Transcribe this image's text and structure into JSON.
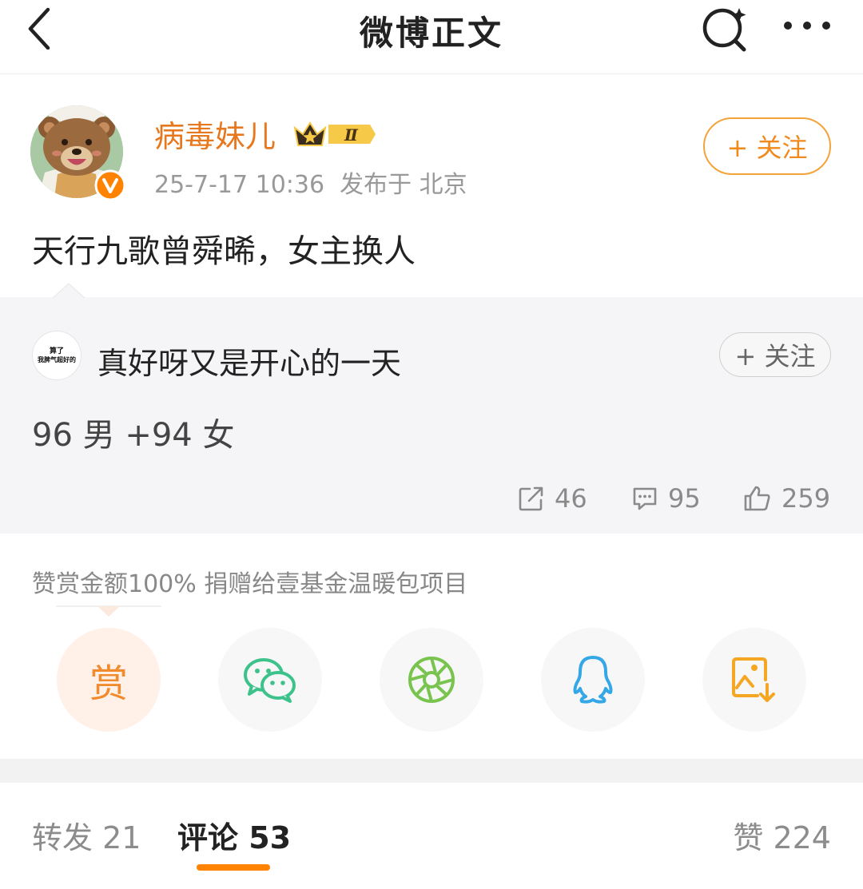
{
  "header": {
    "title": "微博正文"
  },
  "post": {
    "author": "病毒妹儿",
    "level_badge": "Ⅱ",
    "meta": "25-7-17 10:36  发布于 北京",
    "follow_label": "+ 关注",
    "text": "天行九歌曾舜晞，女主换人"
  },
  "quote": {
    "avatar_text_1": "算了",
    "avatar_text_2": "我脾气超好的",
    "author": "真好呀又是开心的一天",
    "follow_label": "+ 关注",
    "text": "96 男 +94 女",
    "stats": {
      "reposts": "46",
      "comments": "95",
      "likes": "259"
    }
  },
  "tip": {
    "text": "赞赏金额100% 捐赠给壹基金温暖包项目",
    "reward_label": "赏"
  },
  "share": [
    {
      "icon": "reward-icon"
    },
    {
      "icon": "wechat-icon",
      "color": "#3cc28a"
    },
    {
      "icon": "moments-icon",
      "color": "#78c44e"
    },
    {
      "icon": "qq-icon",
      "color": "#34a7e6"
    },
    {
      "icon": "save-image-icon",
      "color": "#f5a623"
    }
  ],
  "tabs": {
    "repost": "转发 21",
    "comment": "评论 53",
    "like": "赞 224"
  },
  "colors": {
    "accent": "#ff8200",
    "username": "#e8781e",
    "follow_border": "#f3a33a"
  }
}
